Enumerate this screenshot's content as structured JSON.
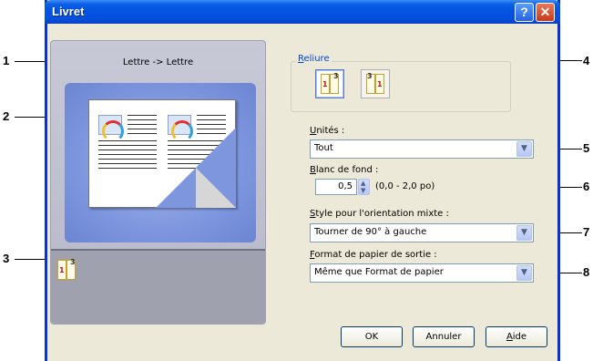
{
  "window": {
    "title": "Livret",
    "help_glyph": "?",
    "close_glyph": "✕"
  },
  "callouts": [
    "1",
    "2",
    "3",
    "4",
    "5",
    "6",
    "7",
    "8"
  ],
  "preview": {
    "caption": "Lettre -> Lettre"
  },
  "binding": {
    "group_label_accel": "R",
    "group_label_rest": "eliure",
    "options": [
      {
        "icon": "left-binding-icon",
        "page1": "1",
        "page3": "3",
        "selected": true
      },
      {
        "icon": "right-binding-icon",
        "page1": "1",
        "page3": "3",
        "selected": false
      }
    ]
  },
  "units": {
    "label_accel": "U",
    "label_rest": "nités :",
    "value": "Tout"
  },
  "gutter": {
    "label_accel": "B",
    "label_rest": "lanc de fond :",
    "value": "0,5",
    "range": "(0,0 - 2,0 po)"
  },
  "mixed_orientation": {
    "label_accel": "S",
    "label_rest": "tyle pour l'orientation mixte :",
    "value": "Tourner de 90° à gauche"
  },
  "output_paper": {
    "label_accel": "F",
    "label_rest": "ormat de papier de sortie :",
    "value": "Même que Format de papier"
  },
  "footer": {
    "ok": "OK",
    "cancel": "Annuler",
    "help_accel": "A",
    "help_rest": "ide"
  },
  "colors": {
    "titlebar": "#0454e0",
    "dialog_bg": "#ece9d8",
    "preview_blue": "#7e96de",
    "link_blue": "#0046d5"
  }
}
